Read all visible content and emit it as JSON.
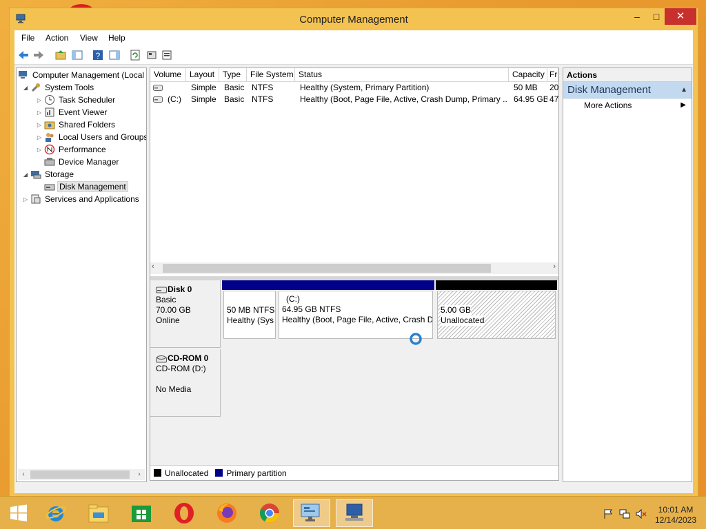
{
  "window": {
    "title": "Computer Management",
    "min_glyph": "–",
    "max_glyph": "□",
    "close_glyph": "✕"
  },
  "menu": [
    "File",
    "Action",
    "View",
    "Help"
  ],
  "tree": [
    {
      "label": "Computer Management (Local",
      "icon": "computer-management-icon",
      "expander": "",
      "indent": 0
    },
    {
      "label": "System Tools",
      "icon": "system-tools-icon",
      "expander": "◢",
      "indent": 1
    },
    {
      "label": "Task Scheduler",
      "icon": "clock-icon",
      "expander": "▷",
      "indent": 2
    },
    {
      "label": "Event Viewer",
      "icon": "event-viewer-icon",
      "expander": "▷",
      "indent": 2
    },
    {
      "label": "Shared Folders",
      "icon": "shared-folders-icon",
      "expander": "▷",
      "indent": 2
    },
    {
      "label": "Local Users and Groups",
      "icon": "users-icon",
      "expander": "▷",
      "indent": 2
    },
    {
      "label": "Performance",
      "icon": "performance-icon",
      "expander": "▷",
      "indent": 2
    },
    {
      "label": "Device Manager",
      "icon": "device-manager-icon",
      "expander": "",
      "indent": 2
    },
    {
      "label": "Storage",
      "icon": "storage-icon",
      "expander": "◢",
      "indent": 1
    },
    {
      "label": "Disk Management",
      "icon": "disk-management-icon",
      "expander": "",
      "indent": 2,
      "selected": true
    },
    {
      "label": "Services and Applications",
      "icon": "services-icon",
      "expander": "▷",
      "indent": 1
    }
  ],
  "volumes": {
    "columns": [
      "Volume",
      "Layout",
      "Type",
      "File System",
      "Status",
      "Capacity",
      "Fr"
    ],
    "rows": [
      [
        "",
        "Simple",
        "Basic",
        "NTFS",
        "Healthy (System, Primary Partition)",
        "50 MB",
        "20"
      ],
      [
        "(C:)",
        "Simple",
        "Basic",
        "NTFS",
        "Healthy (Boot, Page File, Active, Crash Dump, Primary ...",
        "64.95 GB",
        "47"
      ]
    ]
  },
  "disks": [
    {
      "name": "Disk 0",
      "lines": [
        "Basic",
        "70.00 GB",
        "Online"
      ],
      "partitions": [
        {
          "title": "",
          "size": "50 MB NTFS",
          "status": "Healthy (Sys",
          "kind": "primary"
        },
        {
          "title": "(C:)",
          "size": "64.95 GB NTFS",
          "status": "Healthy (Boot, Page File, Active, Crash D",
          "kind": "primary"
        },
        {
          "title": "",
          "size": "5.00 GB",
          "status": "Unallocated",
          "kind": "unallocated"
        }
      ]
    },
    {
      "name": "CD-ROM 0",
      "lines": [
        "CD-ROM (D:)",
        "",
        "No Media"
      ]
    }
  ],
  "legend": [
    {
      "label": "Unallocated",
      "color": "#000000"
    },
    {
      "label": "Primary partition",
      "color": "#00008b"
    }
  ],
  "actions": {
    "header": "Actions",
    "section": "Disk Management",
    "items": [
      "More Actions"
    ]
  },
  "taskbar": {
    "apps": [
      "windows-start",
      "internet-explorer",
      "file-explorer",
      "store",
      "opera",
      "firefox",
      "chrome",
      "computer-management",
      "remote-desktop"
    ],
    "time": "10:01 AM",
    "date": "12/14/2023"
  },
  "colors": {
    "primary_bar": "#00008b",
    "unallocated_bar": "#000000",
    "accent": "#c7302d"
  }
}
